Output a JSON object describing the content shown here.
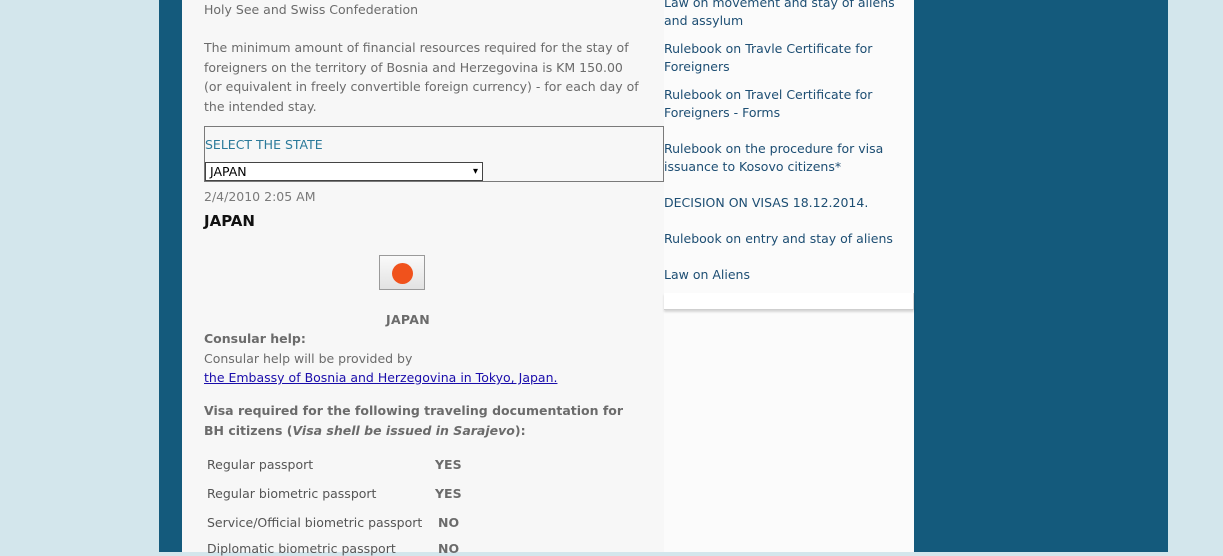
{
  "main": {
    "top_text": "Holy See and Swiss Confederation",
    "min_text": "The minimum amount of financial resources required for the stay of foreigners on the territory of Bosnia and Herzegovina is KM 150.00 (or equivalent in freely convertible foreign currency) - for each day of the intended stay.",
    "state_label": "SELECT THE STATE",
    "state_selected": "JAPAN",
    "date": "2/4/2010 2:05 AM",
    "country_heading": "JAPAN",
    "flag_caption": "JAPAN",
    "consular_heading": "Consular help:",
    "consular_text": "Consular help will be provided by",
    "consular_link": "the Embassy of Bosnia and Herzegovina in Tokyo, Japan.",
    "visa_heading_a": "Visa required for the following traveling documentation for BH citizens (",
    "visa_heading_em": "Visa shell be issued in Sarajevo",
    "visa_heading_b": "):",
    "docs": [
      {
        "label": "Regular passport",
        "value": "YES"
      },
      {
        "label": "Regular biometric passport",
        "value": "YES"
      },
      {
        "label": "Service/Official biometric passport",
        "value": "NO"
      },
      {
        "label": "Diplomatic biometric passport",
        "value": "NO"
      }
    ]
  },
  "sidebar": {
    "links": [
      "Law on movement and stay of aliens and assylum",
      "Rulebook on Travle Certificate for Foreigners",
      "Rulebook on Travel Certificate for Foreigners - Forms",
      "Rulebook on the procedure for visa issuance to Kosovo citizens*",
      "DECISION ON VISAS 18.12.2014.",
      "Rulebook on entry and stay of aliens",
      "Law on Aliens"
    ]
  },
  "colors": {
    "frame": "#145a7c",
    "outer_bg": "#d3e6ec",
    "link": "#1d4e73",
    "flag_red": "#f0521c"
  },
  "icons": {
    "select_arrow": "chevron-down-icon",
    "flag": "japan-flag-icon"
  }
}
